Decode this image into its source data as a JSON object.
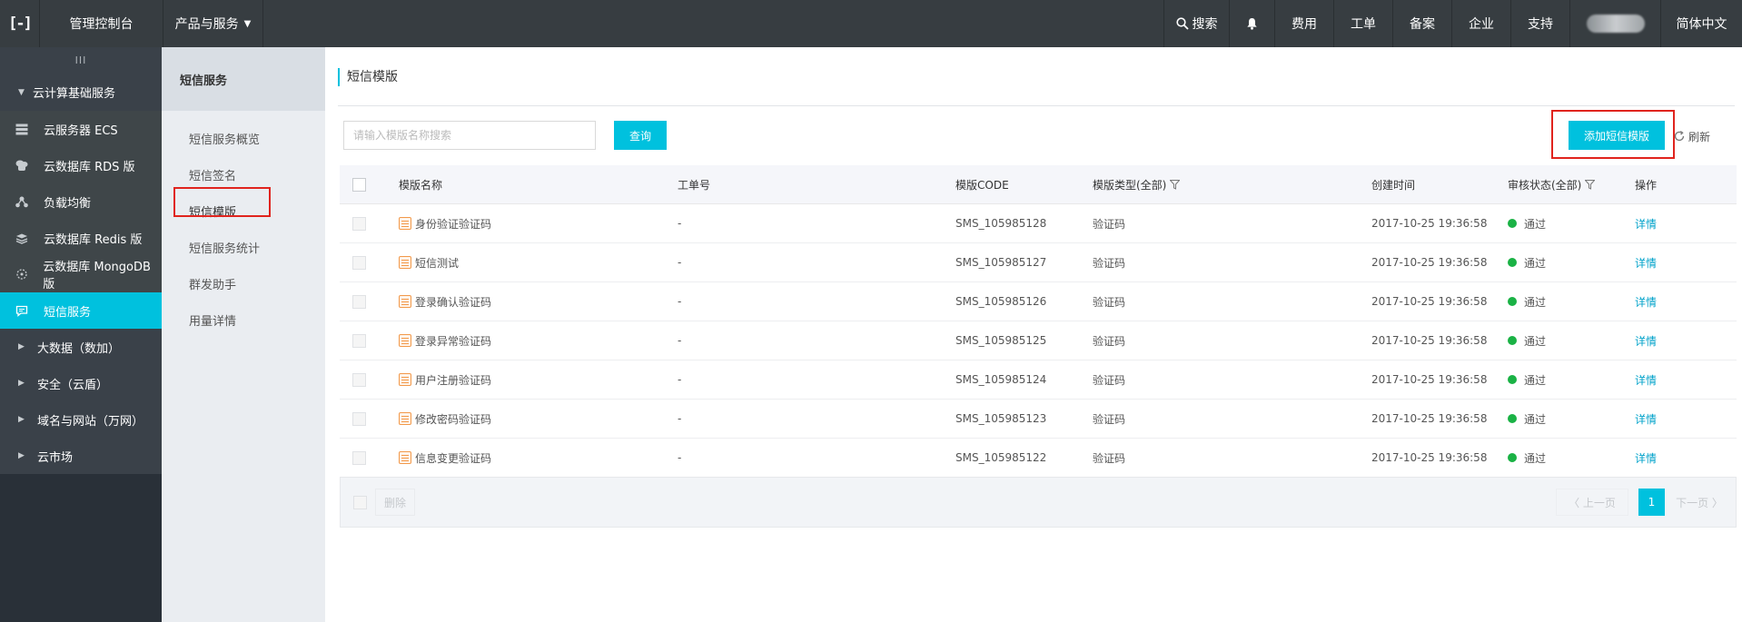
{
  "topbar": {
    "logo": "[-]",
    "console": "管理控制台",
    "products": "产品与服务",
    "search": "搜索",
    "items": [
      "费用",
      "工单",
      "备案",
      "企业",
      "支持"
    ],
    "language": "简体中文"
  },
  "sidebar": {
    "collapse": "III",
    "group_expanded": "云计算基础服务",
    "items": [
      {
        "label": "云服务器 ECS",
        "icon": "server-icon"
      },
      {
        "label": "云数据库 RDS 版",
        "icon": "database-icon"
      },
      {
        "label": "负载均衡",
        "icon": "load-balancer-icon"
      },
      {
        "label": "云数据库 Redis 版",
        "icon": "redis-icon"
      },
      {
        "label": "云数据库 MongoDB 版",
        "icon": "mongodb-icon"
      },
      {
        "label": "短信服务",
        "icon": "sms-icon"
      }
    ],
    "collapsed_groups": [
      "大数据（数加）",
      "安全（云盾）",
      "域名与网站（万网）",
      "云市场"
    ]
  },
  "subnav": {
    "title": "短信服务",
    "items": [
      "短信服务概览",
      "短信签名",
      "短信模版",
      "短信服务统计",
      "群发助手",
      "用量详情"
    ]
  },
  "main": {
    "title": "短信模版",
    "search_placeholder": "请输入模版名称搜索",
    "query_button": "查询",
    "add_button": "添加短信模版",
    "refresh": "刷新",
    "columns": [
      "模版名称",
      "工单号",
      "模版CODE",
      "模版类型(全部)",
      "创建时间",
      "审核状态(全部)",
      "操作"
    ],
    "rows": [
      {
        "name": "身份验证验证码",
        "order": "-",
        "code": "SMS_105985128",
        "type": "验证码",
        "time": "2017-10-25 19:36:58",
        "status": "通过",
        "action": "详情"
      },
      {
        "name": "短信测试",
        "order": "-",
        "code": "SMS_105985127",
        "type": "验证码",
        "time": "2017-10-25 19:36:58",
        "status": "通过",
        "action": "详情"
      },
      {
        "name": "登录确认验证码",
        "order": "-",
        "code": "SMS_105985126",
        "type": "验证码",
        "time": "2017-10-25 19:36:58",
        "status": "通过",
        "action": "详情"
      },
      {
        "name": "登录异常验证码",
        "order": "-",
        "code": "SMS_105985125",
        "type": "验证码",
        "time": "2017-10-25 19:36:58",
        "status": "通过",
        "action": "详情"
      },
      {
        "name": "用户注册验证码",
        "order": "-",
        "code": "SMS_105985124",
        "type": "验证码",
        "time": "2017-10-25 19:36:58",
        "status": "通过",
        "action": "详情"
      },
      {
        "name": "修改密码验证码",
        "order": "-",
        "code": "SMS_105985123",
        "type": "验证码",
        "time": "2017-10-25 19:36:58",
        "status": "通过",
        "action": "详情"
      },
      {
        "name": "信息变更验证码",
        "order": "-",
        "code": "SMS_105985122",
        "type": "验证码",
        "time": "2017-10-25 19:36:58",
        "status": "通过",
        "action": "详情"
      }
    ],
    "footer": {
      "delete": "删除",
      "prev": "上一页",
      "current_page": "1",
      "next": "下一页"
    }
  },
  "colors": {
    "accent": "#00c1de",
    "highlight_box": "#e0241e",
    "status_ok": "#1ab245",
    "link": "#00a2ca"
  }
}
